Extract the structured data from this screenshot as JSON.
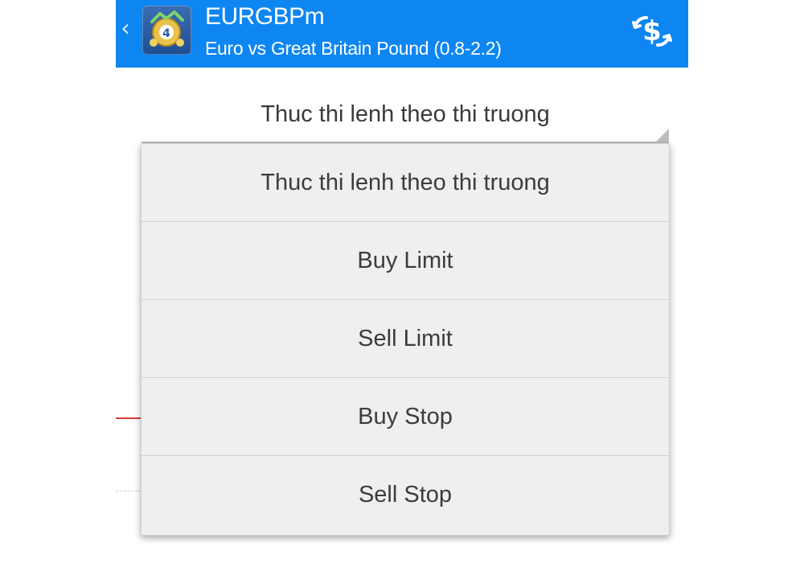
{
  "header": {
    "symbol": "EURGBPm",
    "description": "Euro vs Great Britain Pound (0.8-2.2)",
    "back_icon": "chevron-left-icon",
    "app_icon": "metatrader-4-icon",
    "trade_icon": "exchange-dollar-icon",
    "colors": {
      "bar": "#0d86f2",
      "text": "#ffffff"
    }
  },
  "order_type": {
    "selected": "Thuc thi lenh theo thi truong"
  },
  "dropdown": {
    "options": [
      "Thuc thi lenh theo thi truong",
      "Buy Limit",
      "Sell Limit",
      "Buy Stop",
      "Sell Stop"
    ]
  }
}
